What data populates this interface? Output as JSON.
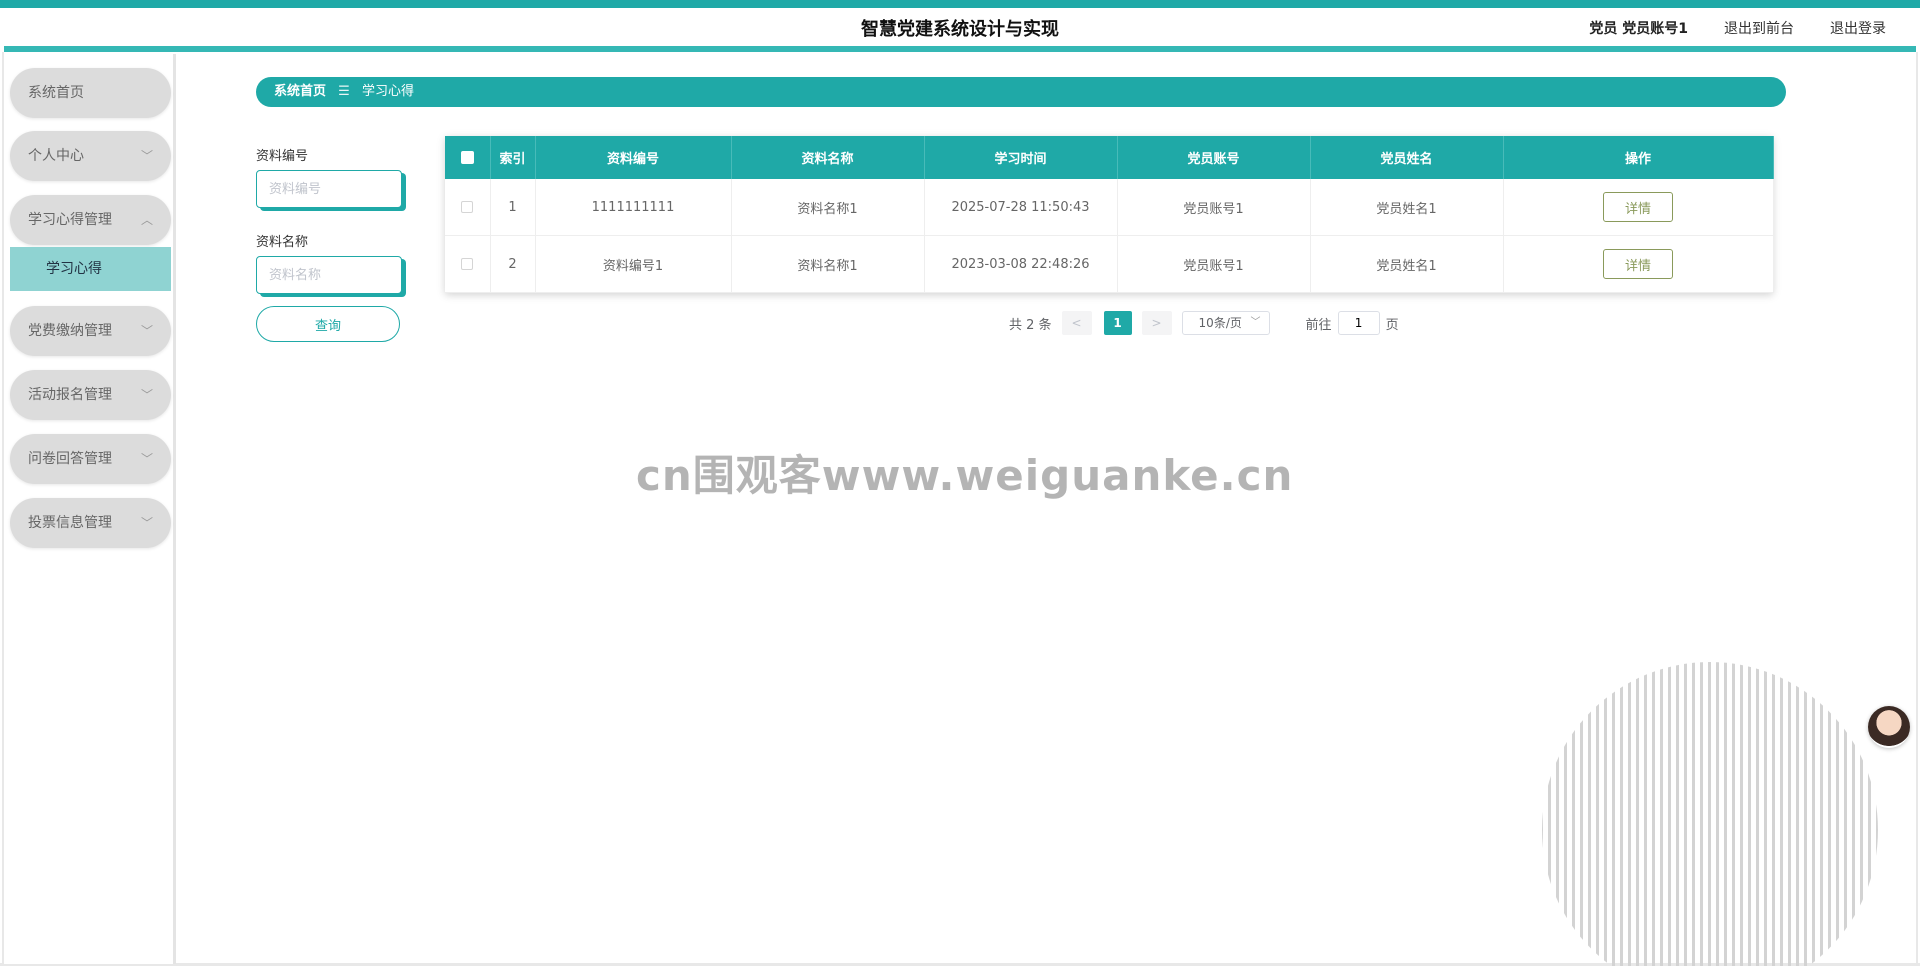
{
  "header": {
    "title": "智慧党建系统设计与实现",
    "user": "党员 党员账号1",
    "links": [
      "退出到前台",
      "退出登录"
    ]
  },
  "sidebar": {
    "items": [
      {
        "label": "系统首页",
        "chevron": ""
      },
      {
        "label": "个人中心",
        "chevron": "﹀"
      },
      {
        "label": "学习心得管理",
        "chevron": "︿"
      },
      {
        "label": "党费缴纳管理",
        "chevron": "﹀"
      },
      {
        "label": "活动报名管理",
        "chevron": "﹀"
      },
      {
        "label": "问卷回答管理",
        "chevron": "﹀"
      },
      {
        "label": "投票信息管理",
        "chevron": "﹀"
      }
    ],
    "active_sub": "学习心得"
  },
  "breadcrumb": {
    "home": "系统首页",
    "separator": "☰",
    "current": "学习心得"
  },
  "search": {
    "field1_label": "资料编号",
    "field1_placeholder": "资料编号",
    "field2_label": "资料名称",
    "field2_placeholder": "资料名称",
    "query_label": "查询"
  },
  "table": {
    "columns": [
      "索引",
      "资料编号",
      "资料名称",
      "学习时间",
      "党员账号",
      "党员姓名",
      "操作"
    ],
    "rows": [
      {
        "index": "1",
        "code": "1111111111",
        "name": "资料名称1",
        "time": "2025-07-28 11:50:43",
        "account": "党员账号1",
        "member": "党员姓名1",
        "action": "详情"
      },
      {
        "index": "2",
        "code": "资料编号1",
        "name": "资料名称1",
        "time": "2023-03-08 22:48:26",
        "account": "党员账号1",
        "member": "党员姓名1",
        "action": "详情"
      }
    ]
  },
  "pagination": {
    "total": "共 2 条",
    "prev": "<",
    "current": "1",
    "next": ">",
    "page_size": "10条/页",
    "goto_prefix": "前往",
    "goto_value": "1",
    "goto_suffix": "页"
  },
  "watermark": "cn围观客www.weiguanke.cn",
  "colors": {
    "accent": "#1fa9a7",
    "sidebar_active": "#8fd3d2",
    "detail_button": "#8a9a5b"
  }
}
